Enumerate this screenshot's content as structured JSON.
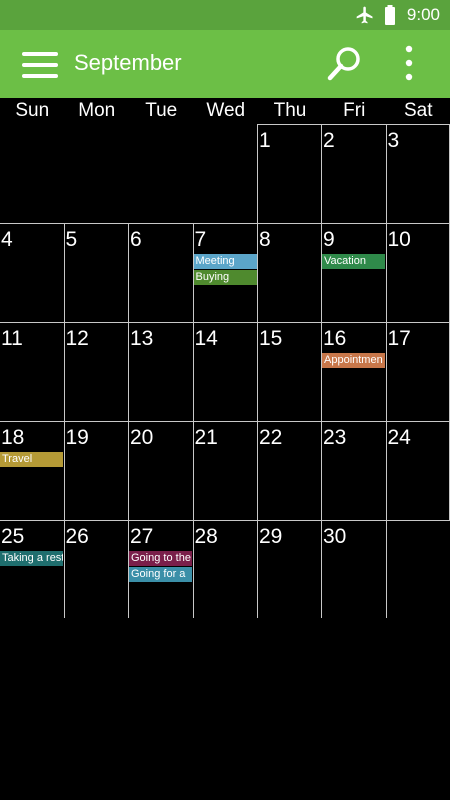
{
  "status_bar": {
    "time": "9:00",
    "icons": [
      "airplane-mode-icon",
      "battery-icon"
    ]
  },
  "app_bar": {
    "title": "September",
    "icons": [
      "hamburger-menu-icon",
      "search-icon",
      "more-vert-icon"
    ],
    "color": "#6cbf46"
  },
  "weekdays": [
    "Sun",
    "Mon",
    "Tue",
    "Wed",
    "Thu",
    "Fri",
    "Sat"
  ],
  "days": [
    "1",
    "2",
    "3",
    "4",
    "5",
    "6",
    "7",
    "8",
    "9",
    "10",
    "11",
    "12",
    "13",
    "14",
    "15",
    "16",
    "17",
    "18",
    "19",
    "20",
    "21",
    "22",
    "23",
    "24",
    "25",
    "26",
    "27",
    "28",
    "29",
    "30"
  ],
  "events": [
    {
      "day": "7",
      "label": "Meeting",
      "color": "#5ba5c9"
    },
    {
      "day": "7",
      "label": "Buying",
      "color": "#4f8a2e"
    },
    {
      "day": "9",
      "label": "Vacation",
      "color": "#2f8a4a"
    },
    {
      "day": "16",
      "label": "Appointmen",
      "color": "#c8774a"
    },
    {
      "day": "18",
      "label": "Travel",
      "color": "#b59a36"
    },
    {
      "day": "25",
      "label": "Taking a rest",
      "color": "#1f6e6e"
    },
    {
      "day": "27",
      "label": "Going to the",
      "color": "#7a1f4a"
    },
    {
      "day": "27",
      "label": "Going for a",
      "color": "#3b8fa8"
    }
  ]
}
